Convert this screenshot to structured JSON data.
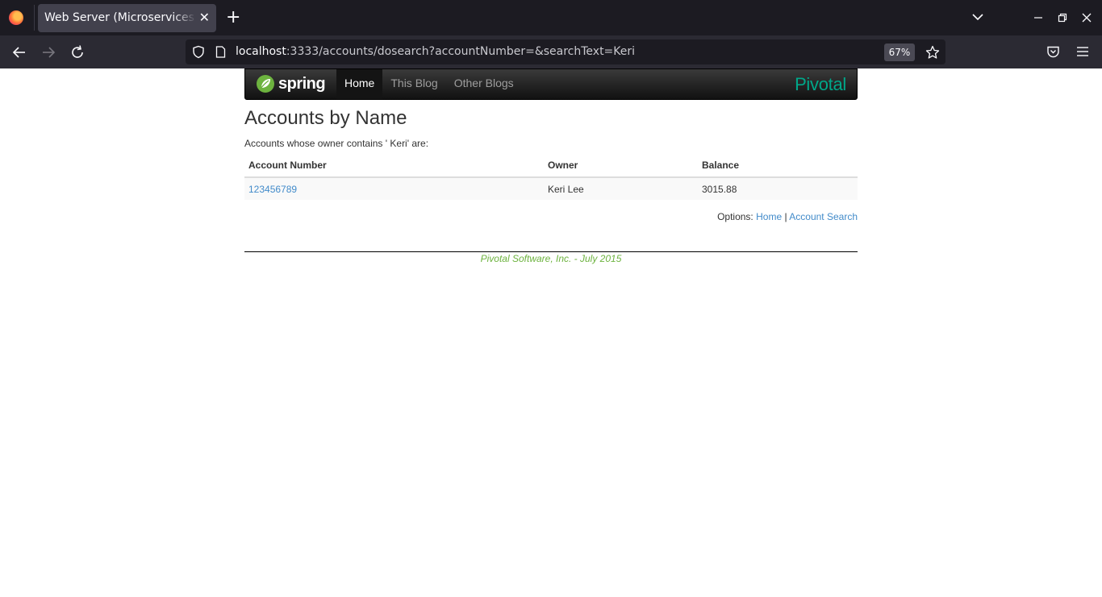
{
  "browser": {
    "tab_title": "Web Server (Microservices Blog)",
    "url_host": "localhost",
    "url_rest": ":3333/accounts/dosearch?accountNumber=&searchText=Keri",
    "zoom": "67%"
  },
  "header": {
    "logo_text": "spring",
    "nav": [
      {
        "label": "Home",
        "active": true
      },
      {
        "label": "This Blog"
      },
      {
        "label": "Other Blogs"
      }
    ],
    "brand": "Pivotal"
  },
  "main": {
    "title": "Accounts by Name",
    "intro": "Accounts whose owner contains ' Keri' are:",
    "table": {
      "headers": [
        "Account Number",
        "Owner",
        "Balance"
      ],
      "rows": [
        {
          "number": "123456789",
          "owner": "Keri Lee",
          "balance": "3015.88"
        }
      ]
    },
    "options": {
      "label": "Options:",
      "home": "Home",
      "separator": "|",
      "search": "Account Search"
    }
  },
  "footer": {
    "text": "Pivotal Software, Inc. - July 2015"
  },
  "colors": {
    "link": "#428bca",
    "spring_green": "#6db33f",
    "pivotal_teal": "#00a789"
  }
}
